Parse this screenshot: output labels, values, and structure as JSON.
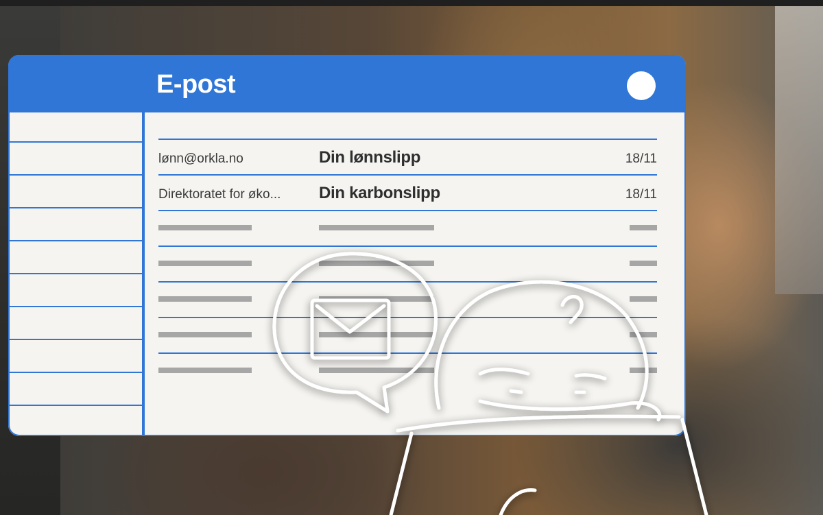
{
  "window": {
    "title": "E-post"
  },
  "emails": [
    {
      "sender": "lønn@orkla.no",
      "subject": "Din lønnslipp",
      "date": "18/11"
    },
    {
      "sender": "Direktoratet for øko...",
      "subject": "Din karbonslipp",
      "date": "18/11"
    }
  ],
  "icons": {
    "close": "close-dot-icon",
    "illustration": [
      "mail-speech-bubble-icon",
      "person-doodle"
    ]
  },
  "colors": {
    "accent": "#2f76d6",
    "paper": "#f5f4f0",
    "placeholder": "#a6a6a6"
  }
}
